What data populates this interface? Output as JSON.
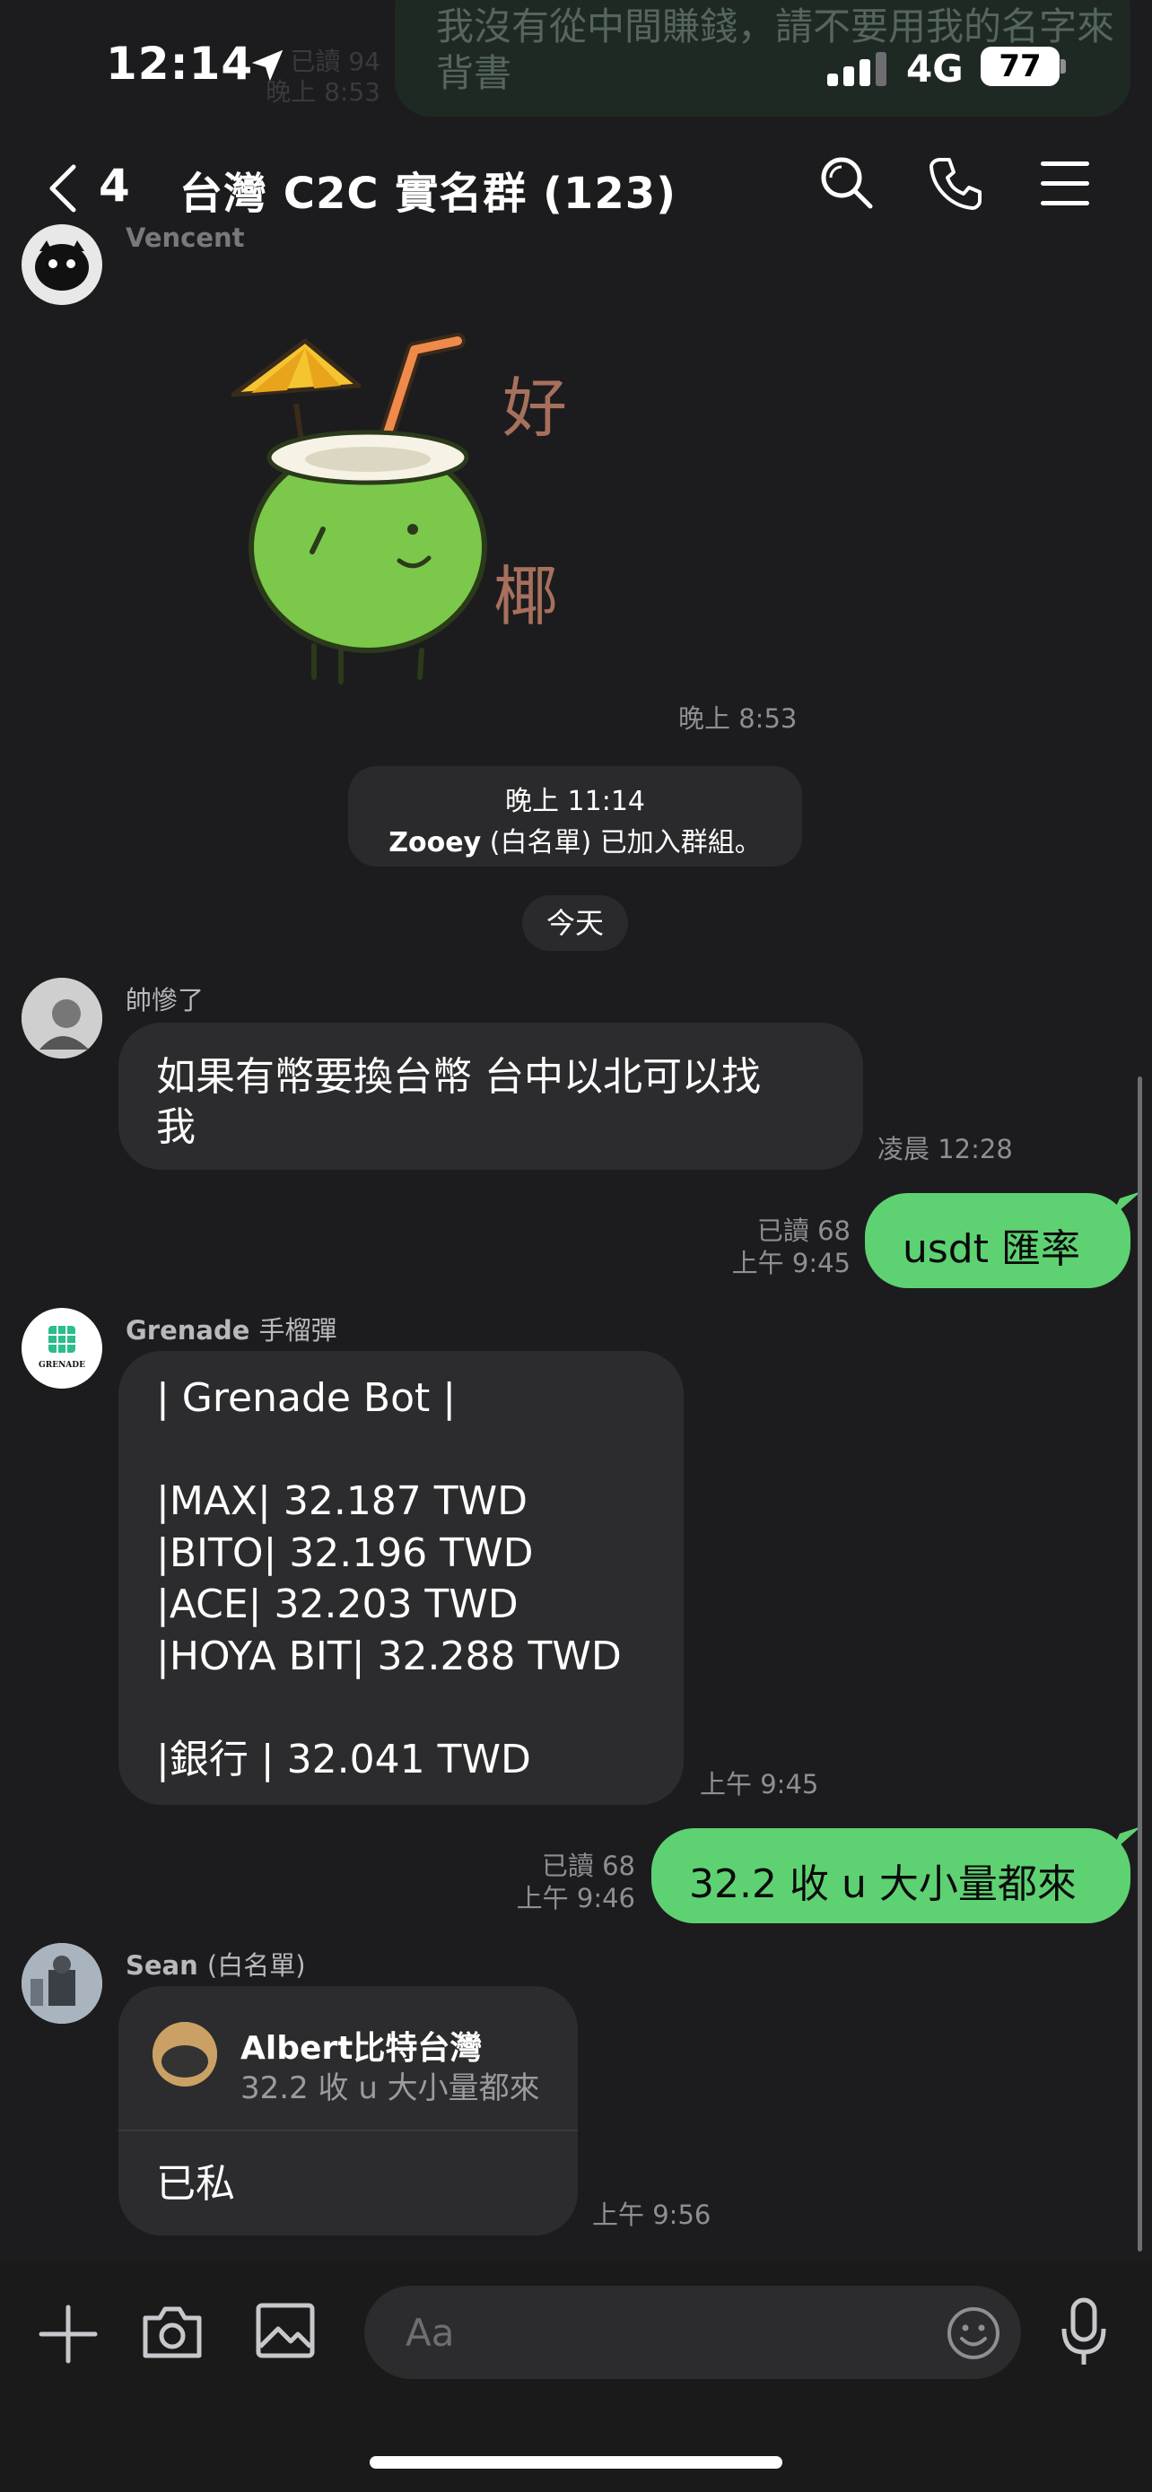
{
  "status_bar": {
    "time": "12:14",
    "network": "4G",
    "battery": "77"
  },
  "pinned_banner": {
    "text": "我沒有從中間賺錢，請不要用我的名字來背書",
    "read_status": "已讀 94",
    "time": "晚上 8:53"
  },
  "header": {
    "back_count": "4",
    "title": "台灣 C2C 實名群 (123)"
  },
  "messages": {
    "vencent": {
      "sender": "Vencent",
      "sticker_text_1": "好",
      "sticker_text_2": "椰",
      "time": "晚上 8:53"
    },
    "system": {
      "time": "晚上 11:14",
      "user": "Zooey",
      "user_tag": "(白名單)",
      "action": "已加入群組。"
    },
    "date_divider": "今天",
    "shuai": {
      "sender": "帥慘了",
      "line1": "如果有幣要換台幣 台中以北可以找",
      "line2": "我",
      "time": "凌晨 12:28"
    },
    "out1": {
      "text": "usdt 匯率",
      "read": "已讀 68",
      "time": "上午 9:45"
    },
    "grenade": {
      "sender": "Grenade",
      "sender_tag": "手榴彈",
      "avatar_label": "GRENADE",
      "lines": [
        "| Grenade Bot |",
        "",
        "|MAX| 32.187 TWD",
        "|BITO| 32.196 TWD",
        "|ACE| 32.203 TWD",
        "|HOYA BIT| 32.288 TWD",
        "",
        "|銀行 | 32.041 TWD"
      ],
      "time": "上午 9:45"
    },
    "out2": {
      "text": "32.2 收 u 大小量都來",
      "read": "已讀 68",
      "time": "上午 9:46"
    },
    "sean": {
      "sender": "Sean",
      "sender_tag": "(白名單)",
      "reply_name": "Albert比特台灣",
      "reply_text": "32.2 收 u 大小量都來",
      "text": "已私",
      "time": "上午 9:56"
    }
  },
  "input": {
    "placeholder": "Aa"
  },
  "icons": {
    "back": "chevron-left-icon",
    "search": "search-icon",
    "call": "phone-icon",
    "menu": "hamburger-menu-icon",
    "plus": "plus-icon",
    "camera": "camera-icon",
    "image": "image-icon",
    "emoji": "emoji-icon",
    "mic": "microphone-icon"
  },
  "colors": {
    "background": "#1c1c1e",
    "bubble_in": "#2c2c2e",
    "bubble_out": "#5ed273",
    "muted_text": "#8e8e93"
  }
}
